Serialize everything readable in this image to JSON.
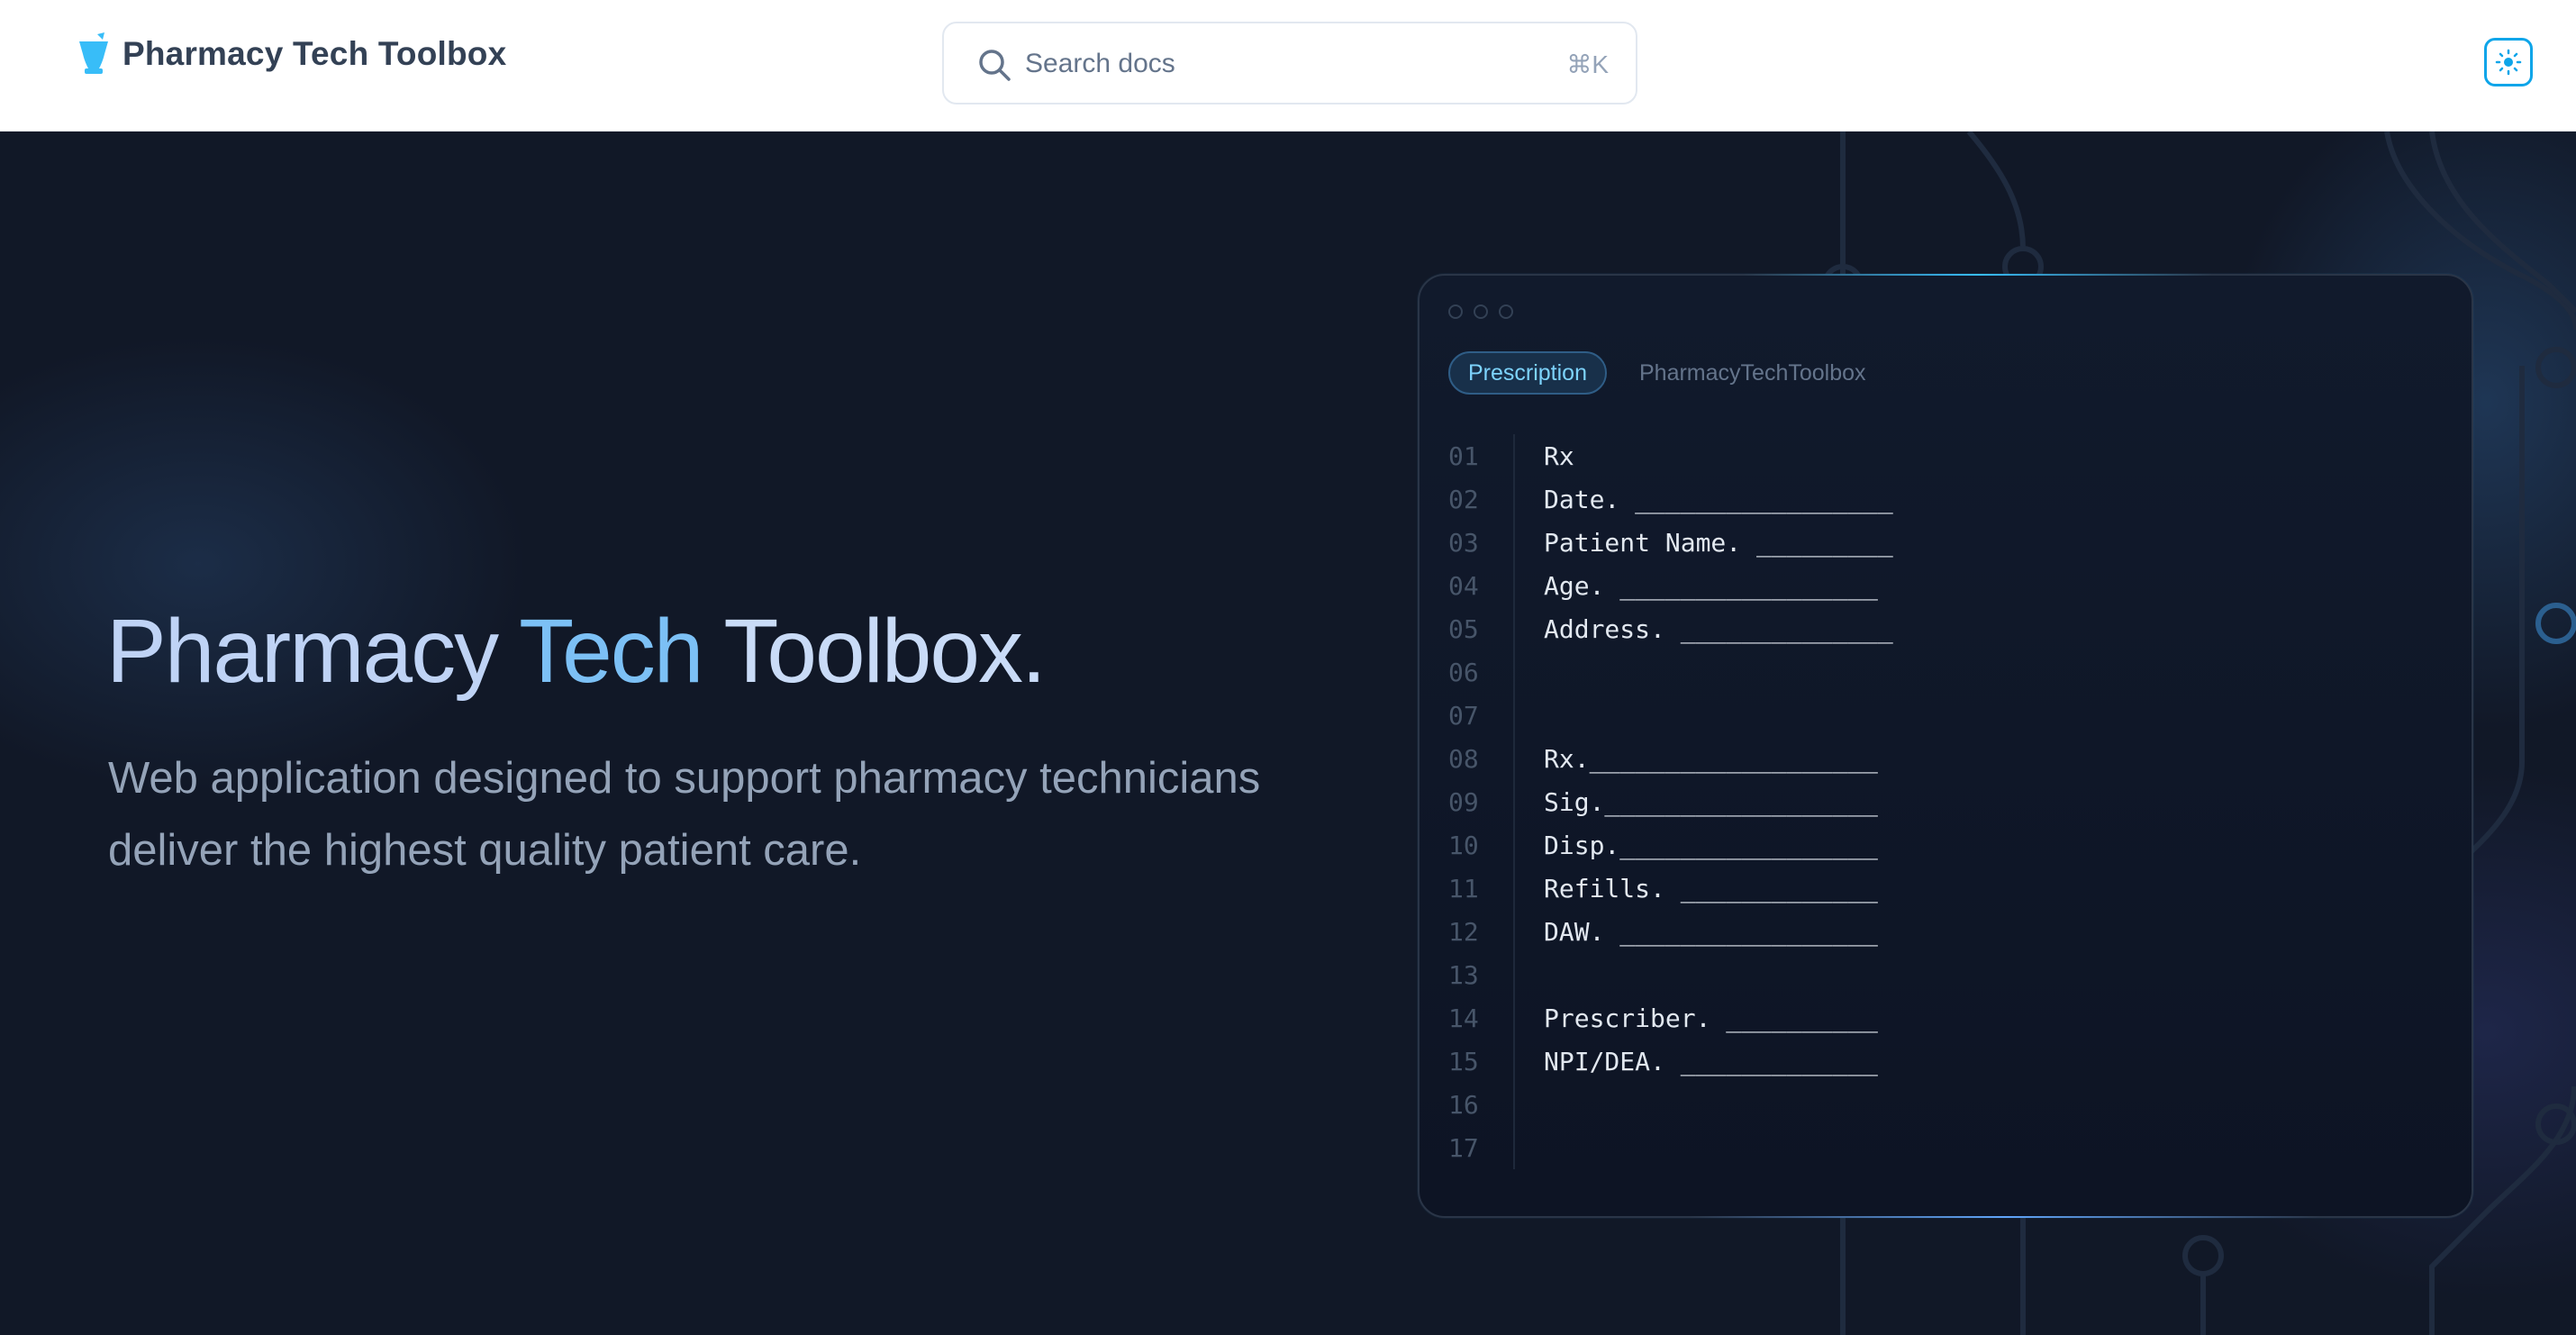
{
  "header": {
    "brand": "Pharmacy Tech Toolbox",
    "search_placeholder": "Search docs",
    "search_shortcut": "⌘K"
  },
  "hero": {
    "title_part1": "Pharmacy ",
    "title_part2": "Tech ",
    "title_part3": "Toolbox.",
    "subtitle": "Web application designed to support pharmacy technicians deliver the highest quality patient care."
  },
  "card": {
    "tab_active": "Prescription",
    "tab_other": "PharmacyTechToolbox",
    "lines": [
      {
        "n": "01",
        "t": "Rx"
      },
      {
        "n": "02",
        "t": "Date. _________________"
      },
      {
        "n": "03",
        "t": "Patient Name. _________"
      },
      {
        "n": "04",
        "t": "Age. _________________"
      },
      {
        "n": "05",
        "t": "Address. ______________"
      },
      {
        "n": "06",
        "t": ""
      },
      {
        "n": "07",
        "t": ""
      },
      {
        "n": "08",
        "t": "Rx.___________________"
      },
      {
        "n": "09",
        "t": "Sig.__________________"
      },
      {
        "n": "10",
        "t": "Disp._________________"
      },
      {
        "n": "11",
        "t": "Refills. _____________"
      },
      {
        "n": "12",
        "t": "DAW. _________________"
      },
      {
        "n": "13",
        "t": ""
      },
      {
        "n": "14",
        "t": "Prescriber. __________"
      },
      {
        "n": "15",
        "t": "NPI/DEA. _____________"
      },
      {
        "n": "16",
        "t": ""
      },
      {
        "n": "17",
        "t": ""
      }
    ]
  },
  "colors": {
    "accent": "#38bdf8",
    "hero_bg": "#111827",
    "title_light": "#bfd3f5",
    "title_accent": "#7cc0f5"
  },
  "icons": {
    "logo": "mortar-pestle-icon",
    "search": "search-icon",
    "theme": "sun-icon"
  }
}
